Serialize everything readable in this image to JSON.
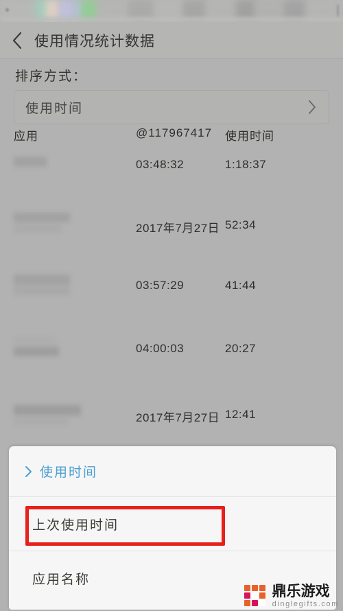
{
  "status_bar": {
    "visible": true,
    "blurred": true
  },
  "header": {
    "back_icon": "chevron-left-icon",
    "title": "使用情况统计数据"
  },
  "sort": {
    "label": "排序方式：",
    "selected_value": "使用时间",
    "chevron_icon": "chevron-right-icon"
  },
  "table": {
    "headers": {
      "app": "应用",
      "last_used": "@117967417",
      "duration": "使用时间"
    },
    "rows": [
      {
        "app": "",
        "last_used": "03:48:32",
        "duration": "1:18:37"
      },
      {
        "app": "",
        "last_used": "2017年7月27日",
        "duration": "52:34"
      },
      {
        "app": "",
        "last_used": "03:57:29",
        "duration": "41:44"
      },
      {
        "app": "",
        "last_used": "04:00:03",
        "duration": "20:27"
      },
      {
        "app": "",
        "last_used": "2017年7月27日",
        "duration": "12:41"
      }
    ]
  },
  "bottom_sheet": {
    "options": [
      {
        "label": "使用时间",
        "selected": true,
        "icon": "chevron-right-icon"
      },
      {
        "label": "上次使用时间",
        "selected": false,
        "highlighted": true
      },
      {
        "label": "应用名称",
        "selected": false
      }
    ]
  },
  "annotation": {
    "highlight_color": "#e8201b",
    "target_option": "上次使用时间"
  },
  "watermark": {
    "title": "鼎乐游戏",
    "domain": "dinglegifts.com"
  },
  "colors": {
    "page_background": "#b2b2b2",
    "header_background": "#b5b6b4",
    "sheet_background": "#f6f6f6",
    "accent_blue": "#4c9fd2",
    "annotation_red": "#e8201b",
    "text_primary": "#33332e"
  }
}
